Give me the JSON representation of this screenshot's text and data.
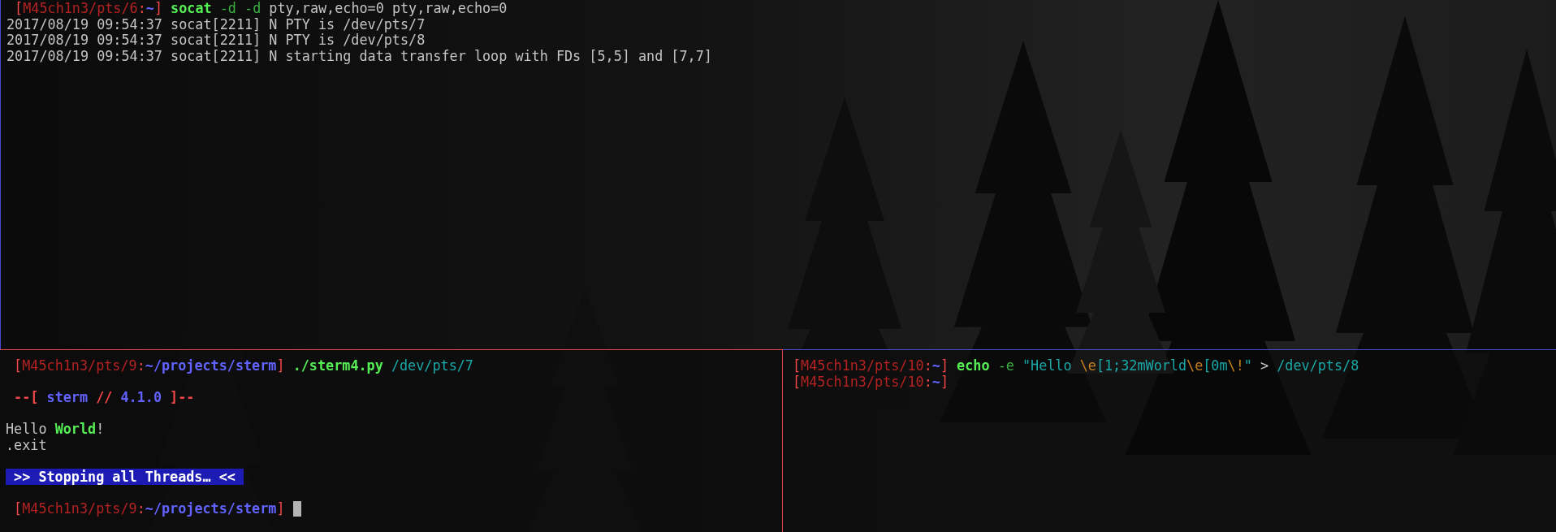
{
  "panes": [
    {
      "selected": false,
      "cursor": false,
      "lines": [
        {
          "kind": "text",
          "segments": [
            {
              "kind": "bracket",
              "text": " ["
            },
            {
              "kind": "host",
              "text": "M45ch1n3/pts/6"
            },
            {
              "kind": "bracket",
              "text": ":"
            },
            {
              "kind": "path",
              "text": "~"
            },
            {
              "kind": "bracket",
              "text": "] "
            },
            {
              "kind": "command",
              "text": "socat "
            },
            {
              "kind": "option",
              "text": "-d -d "
            },
            {
              "kind": "plain",
              "text": "pty,raw,echo=0 pty,raw,echo=0"
            }
          ]
        },
        {
          "kind": "text",
          "segments": [
            {
              "kind": "plain",
              "text": "2017/08/19 09:54:37 socat[2211] N PTY is /dev/pts/7"
            }
          ]
        },
        {
          "kind": "text",
          "segments": [
            {
              "kind": "plain",
              "text": "2017/08/19 09:54:37 socat[2211] N PTY is /dev/pts/8"
            }
          ]
        },
        {
          "kind": "text",
          "segments": [
            {
              "kind": "plain",
              "text": "2017/08/19 09:54:37 socat[2211] N starting data transfer loop with FDs [5,5] and [7,7]"
            }
          ]
        }
      ]
    },
    {
      "selected": true,
      "cursor": true,
      "lines": [
        {
          "kind": "text",
          "segments": [
            {
              "kind": "bracket",
              "text": " ["
            },
            {
              "kind": "host",
              "text": "M45ch1n3/pts/9"
            },
            {
              "kind": "bracket",
              "text": ":"
            },
            {
              "kind": "path",
              "text": "~/projects/sterm"
            },
            {
              "kind": "bracket",
              "text": "] "
            },
            {
              "kind": "command",
              "text": "./sterm4.py "
            },
            {
              "kind": "cyan",
              "text": "/dev/pts/7"
            }
          ]
        },
        {
          "kind": "blank"
        },
        {
          "kind": "text",
          "segments": [
            {
              "kind": "banner",
              "text": " --[ "
            },
            {
              "kind": "path",
              "text": "sterm "
            },
            {
              "kind": "banner",
              "text": "// "
            },
            {
              "kind": "path",
              "text": "4.1.0 "
            },
            {
              "kind": "banner",
              "text": "]--"
            }
          ]
        },
        {
          "kind": "blank"
        },
        {
          "kind": "text",
          "segments": [
            {
              "kind": "plain",
              "text": "Hello "
            },
            {
              "kind": "command",
              "text": "World"
            },
            {
              "kind": "plain",
              "text": "!"
            }
          ]
        },
        {
          "kind": "text",
          "segments": [
            {
              "kind": "plain",
              "text": ".exit"
            }
          ]
        },
        {
          "kind": "blank"
        },
        {
          "kind": "text",
          "segments": [
            {
              "kind": "highlight",
              "text": " >> Stopping all Threads… << "
            }
          ]
        },
        {
          "kind": "blank"
        },
        {
          "kind": "text",
          "segments": [
            {
              "kind": "bracket",
              "text": " ["
            },
            {
              "kind": "host",
              "text": "M45ch1n3/pts/9"
            },
            {
              "kind": "bracket",
              "text": ":"
            },
            {
              "kind": "path",
              "text": "~/projects/sterm"
            },
            {
              "kind": "bracket",
              "text": "] "
            }
          ]
        }
      ]
    },
    {
      "selected": false,
      "cursor": false,
      "lines": [
        {
          "kind": "text",
          "segments": [
            {
              "kind": "bracket",
              "text": "["
            },
            {
              "kind": "host",
              "text": "M45ch1n3/pts/10"
            },
            {
              "kind": "bracket",
              "text": ":"
            },
            {
              "kind": "path",
              "text": "~"
            },
            {
              "kind": "bracket",
              "text": "] "
            },
            {
              "kind": "command",
              "text": "echo "
            },
            {
              "kind": "option",
              "text": "-e "
            },
            {
              "kind": "cyan",
              "text": "\"Hello "
            },
            {
              "kind": "escape",
              "text": "\\e"
            },
            {
              "kind": "cyan",
              "text": "[1;32mWorld"
            },
            {
              "kind": "escape",
              "text": "\\e"
            },
            {
              "kind": "cyan",
              "text": "[0m"
            },
            {
              "kind": "escape",
              "text": "\\!"
            },
            {
              "kind": "cyan",
              "text": "\""
            },
            {
              "kind": "plain",
              "text": " > "
            },
            {
              "kind": "cyan",
              "text": "/dev/pts/8"
            }
          ]
        },
        {
          "kind": "text",
          "segments": [
            {
              "kind": "bracket",
              "text": "["
            },
            {
              "kind": "host",
              "text": "M45ch1n3/pts/10"
            },
            {
              "kind": "bracket",
              "text": ":"
            },
            {
              "kind": "path",
              "text": "~"
            },
            {
              "kind": "bracket",
              "text": "]"
            }
          ]
        }
      ]
    }
  ]
}
